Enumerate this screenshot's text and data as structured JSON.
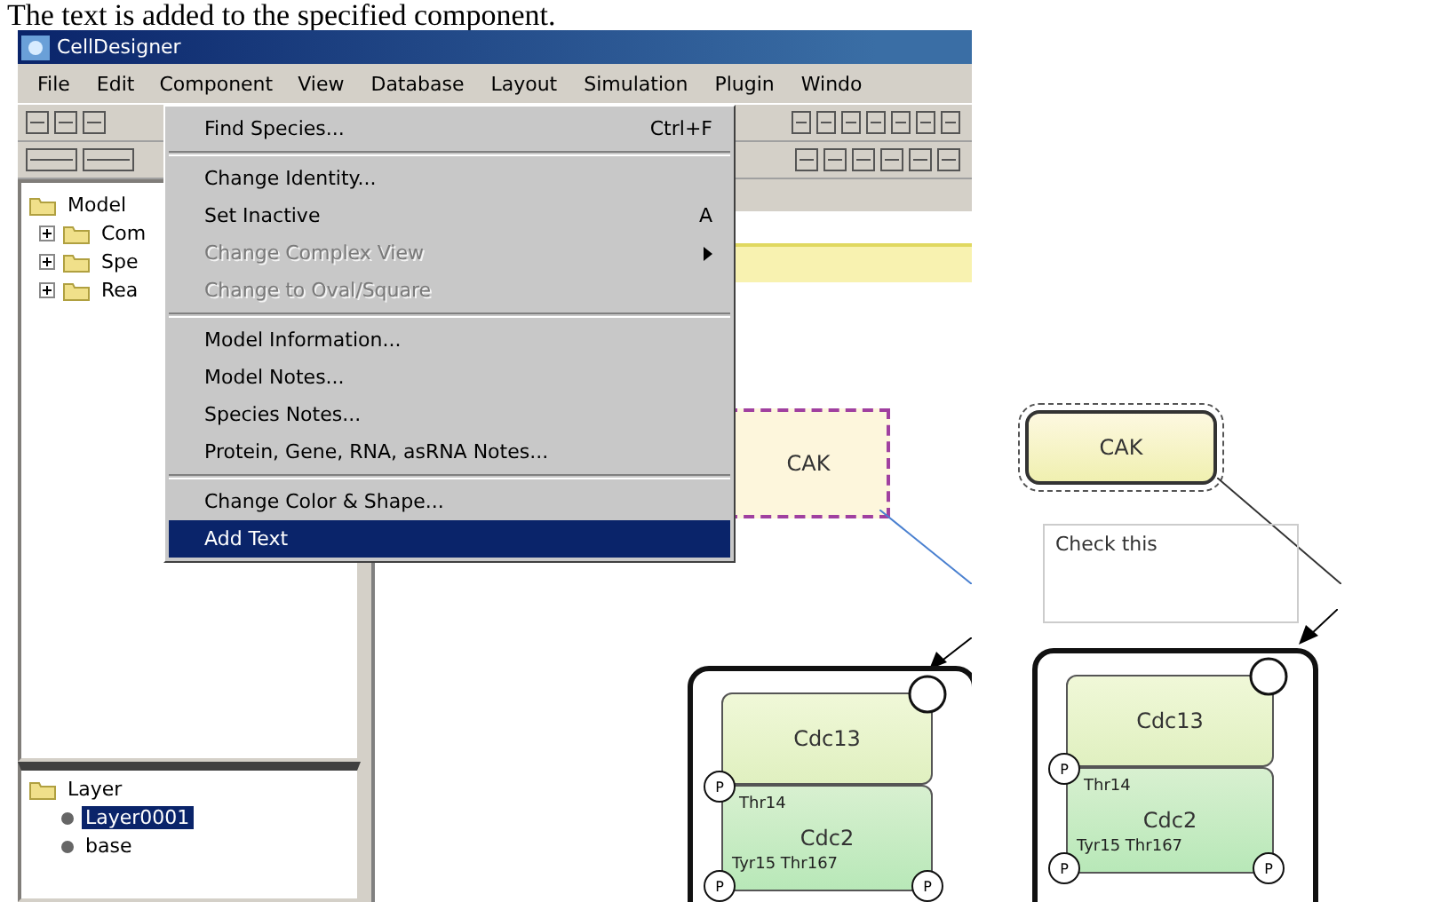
{
  "caption": "The text is added to the specified component.",
  "window": {
    "title": "CellDesigner"
  },
  "menubar": [
    {
      "label": "File",
      "selected": false
    },
    {
      "label": "Edit",
      "selected": false
    },
    {
      "label": "Component",
      "selected": true
    },
    {
      "label": "View",
      "selected": false
    },
    {
      "label": "Database",
      "selected": false
    },
    {
      "label": "Layout",
      "selected": false
    },
    {
      "label": "Simulation",
      "selected": false
    },
    {
      "label": "Plugin",
      "selected": false
    },
    {
      "label": "Windo",
      "selected": false
    }
  ],
  "menu": {
    "items": [
      {
        "kind": "item",
        "label": "Find Species...",
        "shortcut": "Ctrl+F",
        "disabled": false,
        "selected": false,
        "submenu": false
      },
      {
        "kind": "separator"
      },
      {
        "kind": "item",
        "label": "Change Identity...",
        "disabled": false,
        "selected": false,
        "submenu": false
      },
      {
        "kind": "item",
        "label": "Set Inactive",
        "shortcut": "A",
        "disabled": false,
        "selected": false,
        "submenu": false
      },
      {
        "kind": "item",
        "label": "Change Complex View",
        "disabled": true,
        "selected": false,
        "submenu": true
      },
      {
        "kind": "item",
        "label": "Change to Oval/Square",
        "disabled": true,
        "selected": false,
        "submenu": false
      },
      {
        "kind": "separator"
      },
      {
        "kind": "item",
        "label": "Model Information...",
        "disabled": false,
        "selected": false,
        "submenu": false
      },
      {
        "kind": "item",
        "label": "Model Notes...",
        "disabled": false,
        "selected": false,
        "submenu": false
      },
      {
        "kind": "item",
        "label": "Species Notes...",
        "disabled": false,
        "selected": false,
        "submenu": false
      },
      {
        "kind": "item",
        "label": "Protein, Gene, RNA, asRNA Notes...",
        "disabled": false,
        "selected": false,
        "submenu": false
      },
      {
        "kind": "separator"
      },
      {
        "kind": "item",
        "label": "Change Color & Shape...",
        "disabled": false,
        "selected": false,
        "submenu": false
      },
      {
        "kind": "item",
        "label": "Add Text",
        "disabled": false,
        "selected": true,
        "submenu": false
      }
    ]
  },
  "tree": {
    "root": "Model",
    "children": [
      {
        "label": "Com"
      },
      {
        "label": "Spe"
      },
      {
        "label": "Rea"
      }
    ]
  },
  "layers": {
    "root": "Layer",
    "children": [
      {
        "label": "Layer0001",
        "selected": true
      },
      {
        "label": "base",
        "selected": false
      }
    ]
  },
  "canvas": {
    "cak": "CAK",
    "complex": {
      "top": "Cdc13",
      "bottom": "Cdc2",
      "site_top": "Thr14",
      "site_bottom": "Tyr15 Thr167",
      "marks": [
        "P",
        "P",
        "P"
      ]
    }
  },
  "result": {
    "cak": "CAK",
    "note": "Check this",
    "complex": {
      "top": "Cdc13",
      "bottom": "Cdc2",
      "site_top": "Thr14",
      "site_bottom": "Tyr15 Thr167",
      "marks": [
        "P",
        "P",
        "P"
      ]
    }
  }
}
